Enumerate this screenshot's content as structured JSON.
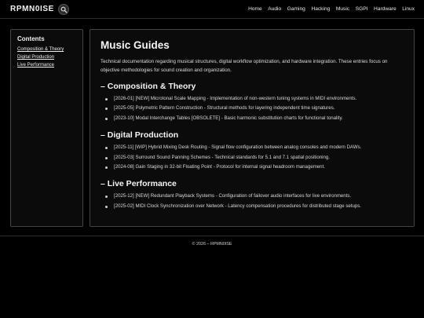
{
  "brand": {
    "title": "RPMN0ISE",
    "icon": "search-icon"
  },
  "nav": [
    "Home",
    "Audio",
    "Gaming",
    "Hacking",
    "Music",
    "SGPI",
    "Hardware",
    "Linux"
  ],
  "sidebar": {
    "heading": "Contents",
    "links": [
      "Composition & Theory",
      "Digital Production",
      "Live Performance"
    ]
  },
  "main": {
    "title": "Music Guides",
    "intro": "Technical documentation regarding musical structures, digital workflow optimization, and hardware integration. These entries focus on objective methodologies for sound creation and organization.",
    "sections": [
      {
        "title": "– Composition & Theory",
        "entries": [
          "[2026-01] [NEW] Microtonal Scale Mapping - Implementation of non-western tuning systems in MIDI environments.",
          "[2025-05] Polymetric Pattern Construction - Structural methods for layering independent time signatures.",
          "[2023-10] Modal Interchange Tables [OBSOLETE] - Basic harmonic substitution charts for functional tonality."
        ]
      },
      {
        "title": "– Digital Production",
        "entries": [
          "[2025-11] [WIP] Hybrid Mixing Desk Routing - Signal flow configuration between analog consoles and modern DAWs.",
          "[2025-03] Surround Sound Panning Schemes - Technical standards for 5.1 and 7.1 spatial positioning.",
          "[2024-08] Gain Staging in 32-bit Floating Point - Protocol for internal signal headroom management."
        ]
      },
      {
        "title": "– Live Performance",
        "entries": [
          "[2025-12] [NEW] Redundant Playback Systems - Configuration of failover audio interfaces for live environments.",
          "[2025-02] MIDI Clock Synchronization over Network - Latency compensation procedures for distributed stage setups."
        ]
      }
    ]
  },
  "footer": {
    "text": "© 2026 – RPMN0ISE"
  }
}
